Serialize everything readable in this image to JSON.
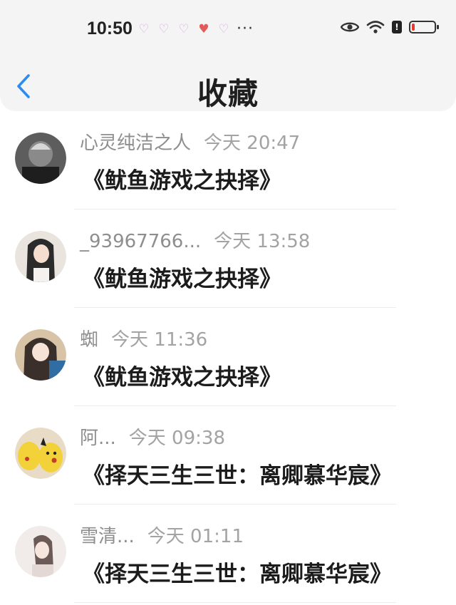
{
  "status_bar": {
    "time": "10:50",
    "notification_icons": [
      "heart",
      "heart",
      "heart",
      "heart-red",
      "heart"
    ],
    "more_dots": "···",
    "battery_level_pct": 10
  },
  "header": {
    "back_icon": "chevron-left",
    "title": "收藏"
  },
  "items": [
    {
      "name": "心灵纯洁之人",
      "time": "今天 20:47",
      "book": "《鱿鱼游戏之抉择》",
      "avatar_colors": [
        "#5d5d5d",
        "#1e1e1e"
      ]
    },
    {
      "name": "_93967766...",
      "time": "今天 13:58",
      "book": "《鱿鱼游戏之抉择》",
      "avatar_colors": [
        "#e9e4de",
        "#2b2b2b"
      ]
    },
    {
      "name": "蜘",
      "time": "今天 11:36",
      "book": "《鱿鱼游戏之抉择》",
      "avatar_colors": [
        "#d9c3a6",
        "#3a2f2a"
      ]
    },
    {
      "name": "阿...",
      "time": "今天 09:38",
      "book": "《择天三生三世：离卿慕华宸》",
      "avatar_colors": [
        "#f2d238",
        "#c23d2a"
      ]
    },
    {
      "name": "雪清...",
      "time": "今天 01:11",
      "book": "《择天三生三世：离卿慕华宸》",
      "avatar_colors": [
        "#f1ece9",
        "#6b5a55"
      ]
    }
  ],
  "colors": {
    "accent_blue": "#2d8cf0",
    "header_bg": "#f4f4f4"
  }
}
